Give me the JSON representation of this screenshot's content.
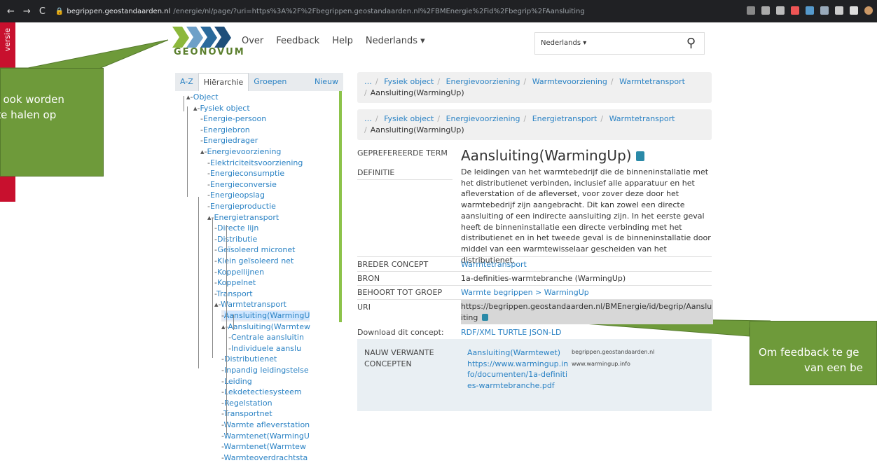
{
  "browser": {
    "url_host": "begrippen.geostandaarden.nl",
    "url_path": "/energie/nl/page/?uri=https%3A%2F%2Fbegrippen.geostandaarden.nl%2FBMEnergie%2Fid%2Fbegrip%2FAansluiting"
  },
  "redstrip": {
    "text": "versie"
  },
  "callouts": {
    "left_line1": "an ook worden",
    "left_line2": "n te halen op",
    "right_line1": "Om feedback te ge",
    "right_line2": "van een be"
  },
  "header": {
    "logo_text": "GEONOVUM",
    "nav": [
      "Over",
      "Feedback",
      "Help",
      "Nederlands ▾"
    ],
    "search_lang": "Nederlands ▾"
  },
  "sidebar": {
    "tabs": [
      "A-Z",
      "Hiërarchie",
      "Groepen",
      "Nieuw"
    ],
    "tree": [
      {
        "label": "Object",
        "prefix": "▴-"
      },
      {
        "label": "Fysiek object",
        "prefix": "▴-"
      },
      {
        "label": "Energie-persoon",
        "prefix": "-"
      },
      {
        "label": "Energiebron",
        "prefix": "-"
      },
      {
        "label": "Energiedrager",
        "prefix": "-"
      },
      {
        "label": "Energievoorziening",
        "prefix": "▴-"
      },
      {
        "label": "Elektriciteitsvoorziening",
        "prefix": "-"
      },
      {
        "label": "Energieconsumptie",
        "prefix": "-"
      },
      {
        "label": "Energieconversie",
        "prefix": "-"
      },
      {
        "label": "Energieopslag",
        "prefix": "-"
      },
      {
        "label": "Energieproductie",
        "prefix": "-"
      },
      {
        "label": "Energietransport",
        "prefix": "▴-"
      },
      {
        "label": "Directe lijn",
        "prefix": "-"
      },
      {
        "label": "Distributie",
        "prefix": "-"
      },
      {
        "label": "Geïsoleerd micronet",
        "prefix": "-"
      },
      {
        "label": "Klein geïsoleerd net",
        "prefix": "-"
      },
      {
        "label": "Koppellijnen",
        "prefix": "-"
      },
      {
        "label": "Koppelnet",
        "prefix": "-"
      },
      {
        "label": "Transport",
        "prefix": "-"
      },
      {
        "label": "Warmtetransport",
        "prefix": "▴-"
      },
      {
        "label": "Aansluiting(WarmingU",
        "prefix": "-"
      },
      {
        "label": "Aansluiting(Warmtew",
        "prefix": "▴-"
      },
      {
        "label": "Centrale aansluitin",
        "prefix": "-"
      },
      {
        "label": "Individuele aanslu",
        "prefix": "-"
      },
      {
        "label": "Distributienet",
        "prefix": "-"
      },
      {
        "label": "Inpandig leidingstelse",
        "prefix": "-"
      },
      {
        "label": "Leiding",
        "prefix": "-"
      },
      {
        "label": "Lekdetectiesysteem",
        "prefix": "-"
      },
      {
        "label": "Regelstation",
        "prefix": "-"
      },
      {
        "label": "Transportnet",
        "prefix": "-"
      },
      {
        "label": "Warmte afleverstation",
        "prefix": "-"
      },
      {
        "label": "Warmtenet(WarmingU",
        "prefix": "-"
      },
      {
        "label": "Warmtenet(Warmtew",
        "prefix": "-"
      },
      {
        "label": "Warmteoverdrachtsta",
        "prefix": "-"
      }
    ]
  },
  "breadcrumbs": [
    {
      "ellipsis": "…",
      "items": [
        "Fysiek object",
        "Energievoorziening",
        "Warmtevoorziening",
        "Warmtetransport"
      ],
      "current": "Aansluiting(WarmingUp)"
    },
    {
      "ellipsis": "…",
      "items": [
        "Fysiek object",
        "Energievoorziening",
        "Energietransport",
        "Warmtetransport"
      ],
      "current": "Aansluiting(WarmingUp)"
    }
  ],
  "concept": {
    "preferred_label": "GEPREFEREERDE TERM",
    "term": "Aansluiting(WarmingUp)",
    "definition_label": "DEFINITIE",
    "definition": "De leidingen van het warmtebedrijf die de binneninstallatie met het distributienet verbinden, inclusief alle apparatuur en het afleverstation of de afleverset, voor zover deze door het warmtebedrijf zijn aangebracht. Dit kan zowel een directe aansluiting of een indirecte aansluiting zijn. In het eerste geval heeft de binneninstallatie een directe verbinding met het distributienet en in het tweede geval is de binneninstallatie door middel van een warmtewisselaar gescheiden van het distributienet.",
    "broader_label": "BREDER CONCEPT",
    "broader": "Warmtetransport",
    "source_label": "BRON",
    "source": "1a-definities-warmtebranche (WarmingUp)",
    "group_label": "BEHOORT TOT GROEP",
    "group": "Warmte begrippen > WarmingUp",
    "uri_label": "URI",
    "uri": "https://begrippen.geostandaarden.nl/BMEnergie/id/begrip/Aansluiting",
    "download_label": "Download dit concept:",
    "download": [
      "RDF/XML",
      "TURTLE",
      "JSON-LD"
    ],
    "related_label": "NAUW VERWANTE CONCEPTEN",
    "related_link": "Aansluiting(Warmtewet)",
    "related_url": "https://www.warmingup.info/documenten/1a-definities-warmtebranche.pdf",
    "related_src1": "begrippen.geostandaarden.nl",
    "related_src2": "www.warmingup.info"
  },
  "colors": {
    "accent": "#2a82c4",
    "green": "#6e9a3a",
    "red": "#c8102e",
    "chrome": "#202124"
  }
}
